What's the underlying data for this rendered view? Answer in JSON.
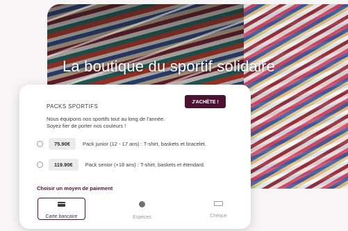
{
  "hero": {
    "title": "La boutique du sportif solidaire"
  },
  "card": {
    "section_title": "PACKS SPORTIFS",
    "buy_label": "J'ACHÈTE !",
    "description_line1": "Nous équipons nos sportifs tout au long de l'année.",
    "description_line2": "Soyez fier de porter nos couleurs !",
    "options": [
      {
        "price": "75.90€",
        "label": "Pack junior (12 - 17 ans) : T-shirt, baskets et bracelet."
      },
      {
        "price": "119.90€",
        "label": "Pack senior (+18 ans) : T-shirt, baskets et étendard."
      }
    ],
    "payment_title": "Choisir un moyen de paiement",
    "payment_methods": [
      {
        "label": "Carte bancaire",
        "icon": "credit-card-icon",
        "selected": true
      },
      {
        "label": "Espèces",
        "icon": "coin-icon",
        "selected": false
      },
      {
        "label": "Chèque",
        "icon": "cheque-icon",
        "selected": false
      }
    ]
  },
  "colors": {
    "accent": "#4b1331",
    "price_background": "#ecebec"
  }
}
